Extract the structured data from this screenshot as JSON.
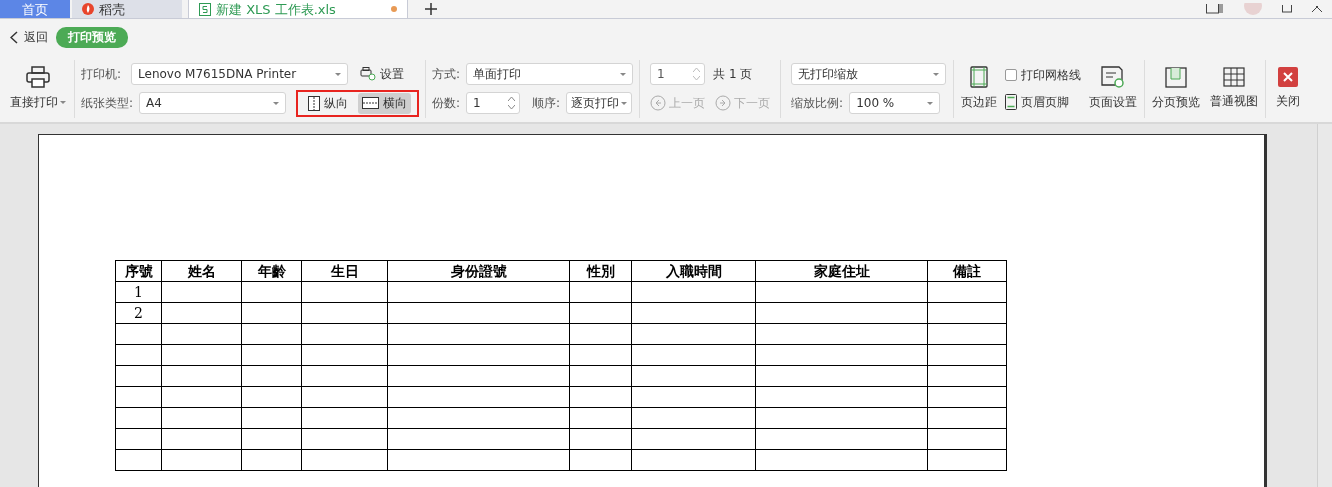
{
  "tabs": [
    {
      "label": "首页",
      "kind": "home",
      "selected": false
    },
    {
      "label": "稻壳",
      "kind": "docer",
      "selected": false
    },
    {
      "label": "新建 XLS 工作表.xls",
      "kind": "sheet",
      "selected": true,
      "unsaved": true
    }
  ],
  "header": {
    "back": "返回",
    "mode": "打印预览"
  },
  "toolbar": {
    "direct_print": "直接打印",
    "printer": {
      "label": "打印机:",
      "value": "Lenovo M7615DNA Printer",
      "settings": "设置"
    },
    "paper": {
      "label": "纸张类型:",
      "value": "A4"
    },
    "orientation": [
      {
        "label": "纵向",
        "kind": "portrait",
        "selected": false
      },
      {
        "label": "横向",
        "kind": "landscape",
        "selected": true
      }
    ],
    "method": {
      "label": "方式:",
      "value": "单面打印"
    },
    "copies": {
      "label": "份数:",
      "value": "1"
    },
    "order": {
      "label": "顺序:",
      "value": "逐页打印"
    },
    "page": {
      "value": "1",
      "total": "共 1 页",
      "prev": "上一页",
      "next": "下一页",
      "prev_disabled": true,
      "next_disabled": true
    },
    "scaling": {
      "value": "无打印缩放",
      "label": "缩放比例:",
      "zoom": "100 %"
    },
    "margins": "页边距",
    "gridlines": {
      "label": "打印网格线",
      "checked": false
    },
    "header_footer": "页眉页脚",
    "page_setup": "页面设置",
    "page_break_preview": "分页预览",
    "normal_view": "普通视图",
    "close": "关闭"
  },
  "sheet": {
    "columns": [
      "序號",
      "姓名",
      "年齡",
      "生日",
      "身份證號",
      "性別",
      "入職時間",
      "家庭住址",
      "備註"
    ],
    "rows": [
      [
        "1"
      ],
      [
        "2"
      ],
      [],
      [],
      [],
      [],
      [],
      [],
      []
    ]
  }
}
